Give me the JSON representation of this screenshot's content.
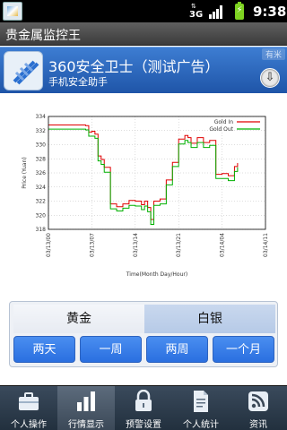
{
  "status_bar": {
    "time": "9:38",
    "network_icon": "3g-network-icon",
    "network_text": "3G",
    "signal_icon": "signal-icon",
    "battery_icon": "battery-charging-icon"
  },
  "app": {
    "title": "贵金属监控王"
  },
  "ad": {
    "title": "360安全卫士（测试广告）",
    "subtitle": "手机安全助手",
    "badge": "有米",
    "icon": "360-security-app-icon",
    "download_icon": "download-arrow-icon"
  },
  "chart_data": {
    "type": "line",
    "xlabel": "Time(Month Day/Hour)",
    "ylabel": "Price (Yuan)",
    "ylim": [
      318,
      334
    ],
    "yticks": [
      318,
      320,
      322,
      324,
      326,
      328,
      330,
      332,
      334
    ],
    "xtick_labels": [
      "03/13/00",
      "03/13/07",
      "03/13/14",
      "03/13/21",
      "03/14/04",
      "03/14/11"
    ],
    "legend_position": "top-right",
    "x_positions_unit": "hours since first tick label",
    "series": [
      {
        "name": "Gold In",
        "color": "#e00000",
        "x": [
          0,
          3,
          6,
          6.5,
          7,
          7.5,
          8,
          8.5,
          9,
          10,
          11,
          12,
          13,
          14,
          15,
          15.5,
          16,
          16.5,
          17,
          18,
          19,
          20,
          21,
          22,
          22.5,
          23,
          24,
          25,
          26,
          27,
          28,
          29,
          30,
          30.5
        ],
        "values": [
          332.8,
          332.8,
          332.7,
          331.8,
          331.9,
          331.5,
          328.4,
          327.9,
          326.8,
          321.6,
          321.2,
          321.6,
          322.1,
          322.0,
          321.5,
          322.0,
          321.1,
          319.4,
          322.0,
          322.3,
          325.0,
          327.5,
          330.8,
          331.3,
          331.0,
          330.2,
          331.0,
          330.3,
          330.6,
          325.8,
          325.9,
          325.6,
          326.9,
          327.4
        ]
      },
      {
        "name": "Gold Out",
        "color": "#00b000",
        "x": [
          0,
          3,
          6,
          6.5,
          7,
          7.5,
          8,
          8.5,
          9,
          10,
          11,
          12,
          13,
          14,
          15,
          15.5,
          16,
          16.5,
          17,
          18,
          19,
          20,
          21,
          22,
          22.5,
          23,
          24,
          25,
          26,
          27,
          28,
          29,
          30,
          30.5
        ],
        "values": [
          332.2,
          332.2,
          332.1,
          331.2,
          331.2,
          330.9,
          327.7,
          327.2,
          326.1,
          320.9,
          320.6,
          321.0,
          321.4,
          321.3,
          320.8,
          321.3,
          320.5,
          318.7,
          321.4,
          321.6,
          324.3,
          326.9,
          330.1,
          330.6,
          330.3,
          329.6,
          330.3,
          329.6,
          329.9,
          325.2,
          325.2,
          324.9,
          326.2,
          326.8
        ]
      }
    ]
  },
  "metal_tabs": [
    {
      "label": "黄金",
      "selected": true
    },
    {
      "label": "白银",
      "selected": false
    }
  ],
  "periods": [
    {
      "label": "两天"
    },
    {
      "label": "一周"
    },
    {
      "label": "两周"
    },
    {
      "label": "一个月"
    }
  ],
  "bottom_nav": {
    "active_index": 1,
    "items": [
      {
        "label": "个人操作",
        "icon": "briefcase-icon"
      },
      {
        "label": "行情显示",
        "icon": "bar-chart-icon"
      },
      {
        "label": "预警设置",
        "icon": "lock-icon"
      },
      {
        "label": "个人统计",
        "icon": "document-icon"
      },
      {
        "label": "资讯",
        "icon": "rss-feed-icon"
      }
    ]
  }
}
